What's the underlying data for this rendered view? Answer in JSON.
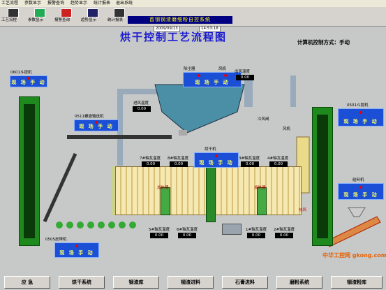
{
  "menu": [
    "工艺流程",
    "参数显示",
    "报警查询",
    "趋势显示",
    "统计报表",
    "退出系统"
  ],
  "toolbar": {
    "buttons": [
      "工艺流程",
      "参数显示",
      "报警查询",
      "趋势显示",
      "统计报表"
    ],
    "banner": "首钢钢渣磨细粉自控系统",
    "date": "2009/09/13",
    "time": "14:53:18"
  },
  "title": "烘干控制工艺流程图",
  "control_mode": {
    "label": "计算机控制方式：",
    "value": "手动"
  },
  "panels": {
    "elevator_0601": {
      "title": "0601斗提机",
      "status": "现 场 手 动"
    },
    "screw_0511": {
      "title": "0511螺旋输送机",
      "status": "现 场 手 动"
    },
    "dust_collector": {
      "title": "除尘器",
      "status": "现 场 手 动"
    },
    "fan": {
      "title": "风机"
    },
    "dryer": {
      "title": "烘干机",
      "status": "现 场 手 动"
    },
    "elevator_0501": {
      "title": "0501斗提机",
      "status": "现 场 手 动"
    },
    "feeder": {
      "title": "给料机",
      "status": "现 场 手 动"
    },
    "belt_0505": {
      "title": "0505皮带机",
      "status": "现 场 手 动"
    }
  },
  "readings": {
    "outlet_air_temp": {
      "label": "出风温度",
      "value": "0.00"
    },
    "inlet_air_temp": {
      "label": "进风温度",
      "value": "0.00"
    },
    "bearing_7": {
      "label": "7#轴瓦温度",
      "value": "0.00"
    },
    "bearing_8": {
      "label": "8#轴瓦温度",
      "value": "0.00"
    },
    "bearing_3": {
      "label": "3#轴瓦温度",
      "value": "0.00"
    },
    "bearing_4": {
      "label": "4#轴瓦温度",
      "value": "0.00"
    },
    "bearing_5": {
      "label": "5#轴瓦温度",
      "value": "0.00"
    },
    "bearing_6": {
      "label": "6#轴瓦温度",
      "value": "0.00"
    },
    "bearing_1": {
      "label": "1#轴瓦温度",
      "value": "0.00"
    },
    "bearing_2": {
      "label": "2#轴瓦温度",
      "value": "0.00"
    }
  },
  "labels": {
    "cold_air_valve": "冷风阀",
    "fan_label": "风机",
    "driver_left": "加热器",
    "driver_right": "加热器",
    "hot_air": "热风"
  },
  "bottom_buttons": [
    "应  急",
    "烘干系统",
    "钢渣库",
    "钢渣进料",
    "石膏进料",
    "磨粉系统",
    "钢渣粉库"
  ],
  "watermark": "中华工控网 gkong.com",
  "colors": {
    "panel": "#1a4fd6",
    "status_text": "#ffff66",
    "title": "#1b1bd0",
    "elevator": "#1e8a1e"
  }
}
